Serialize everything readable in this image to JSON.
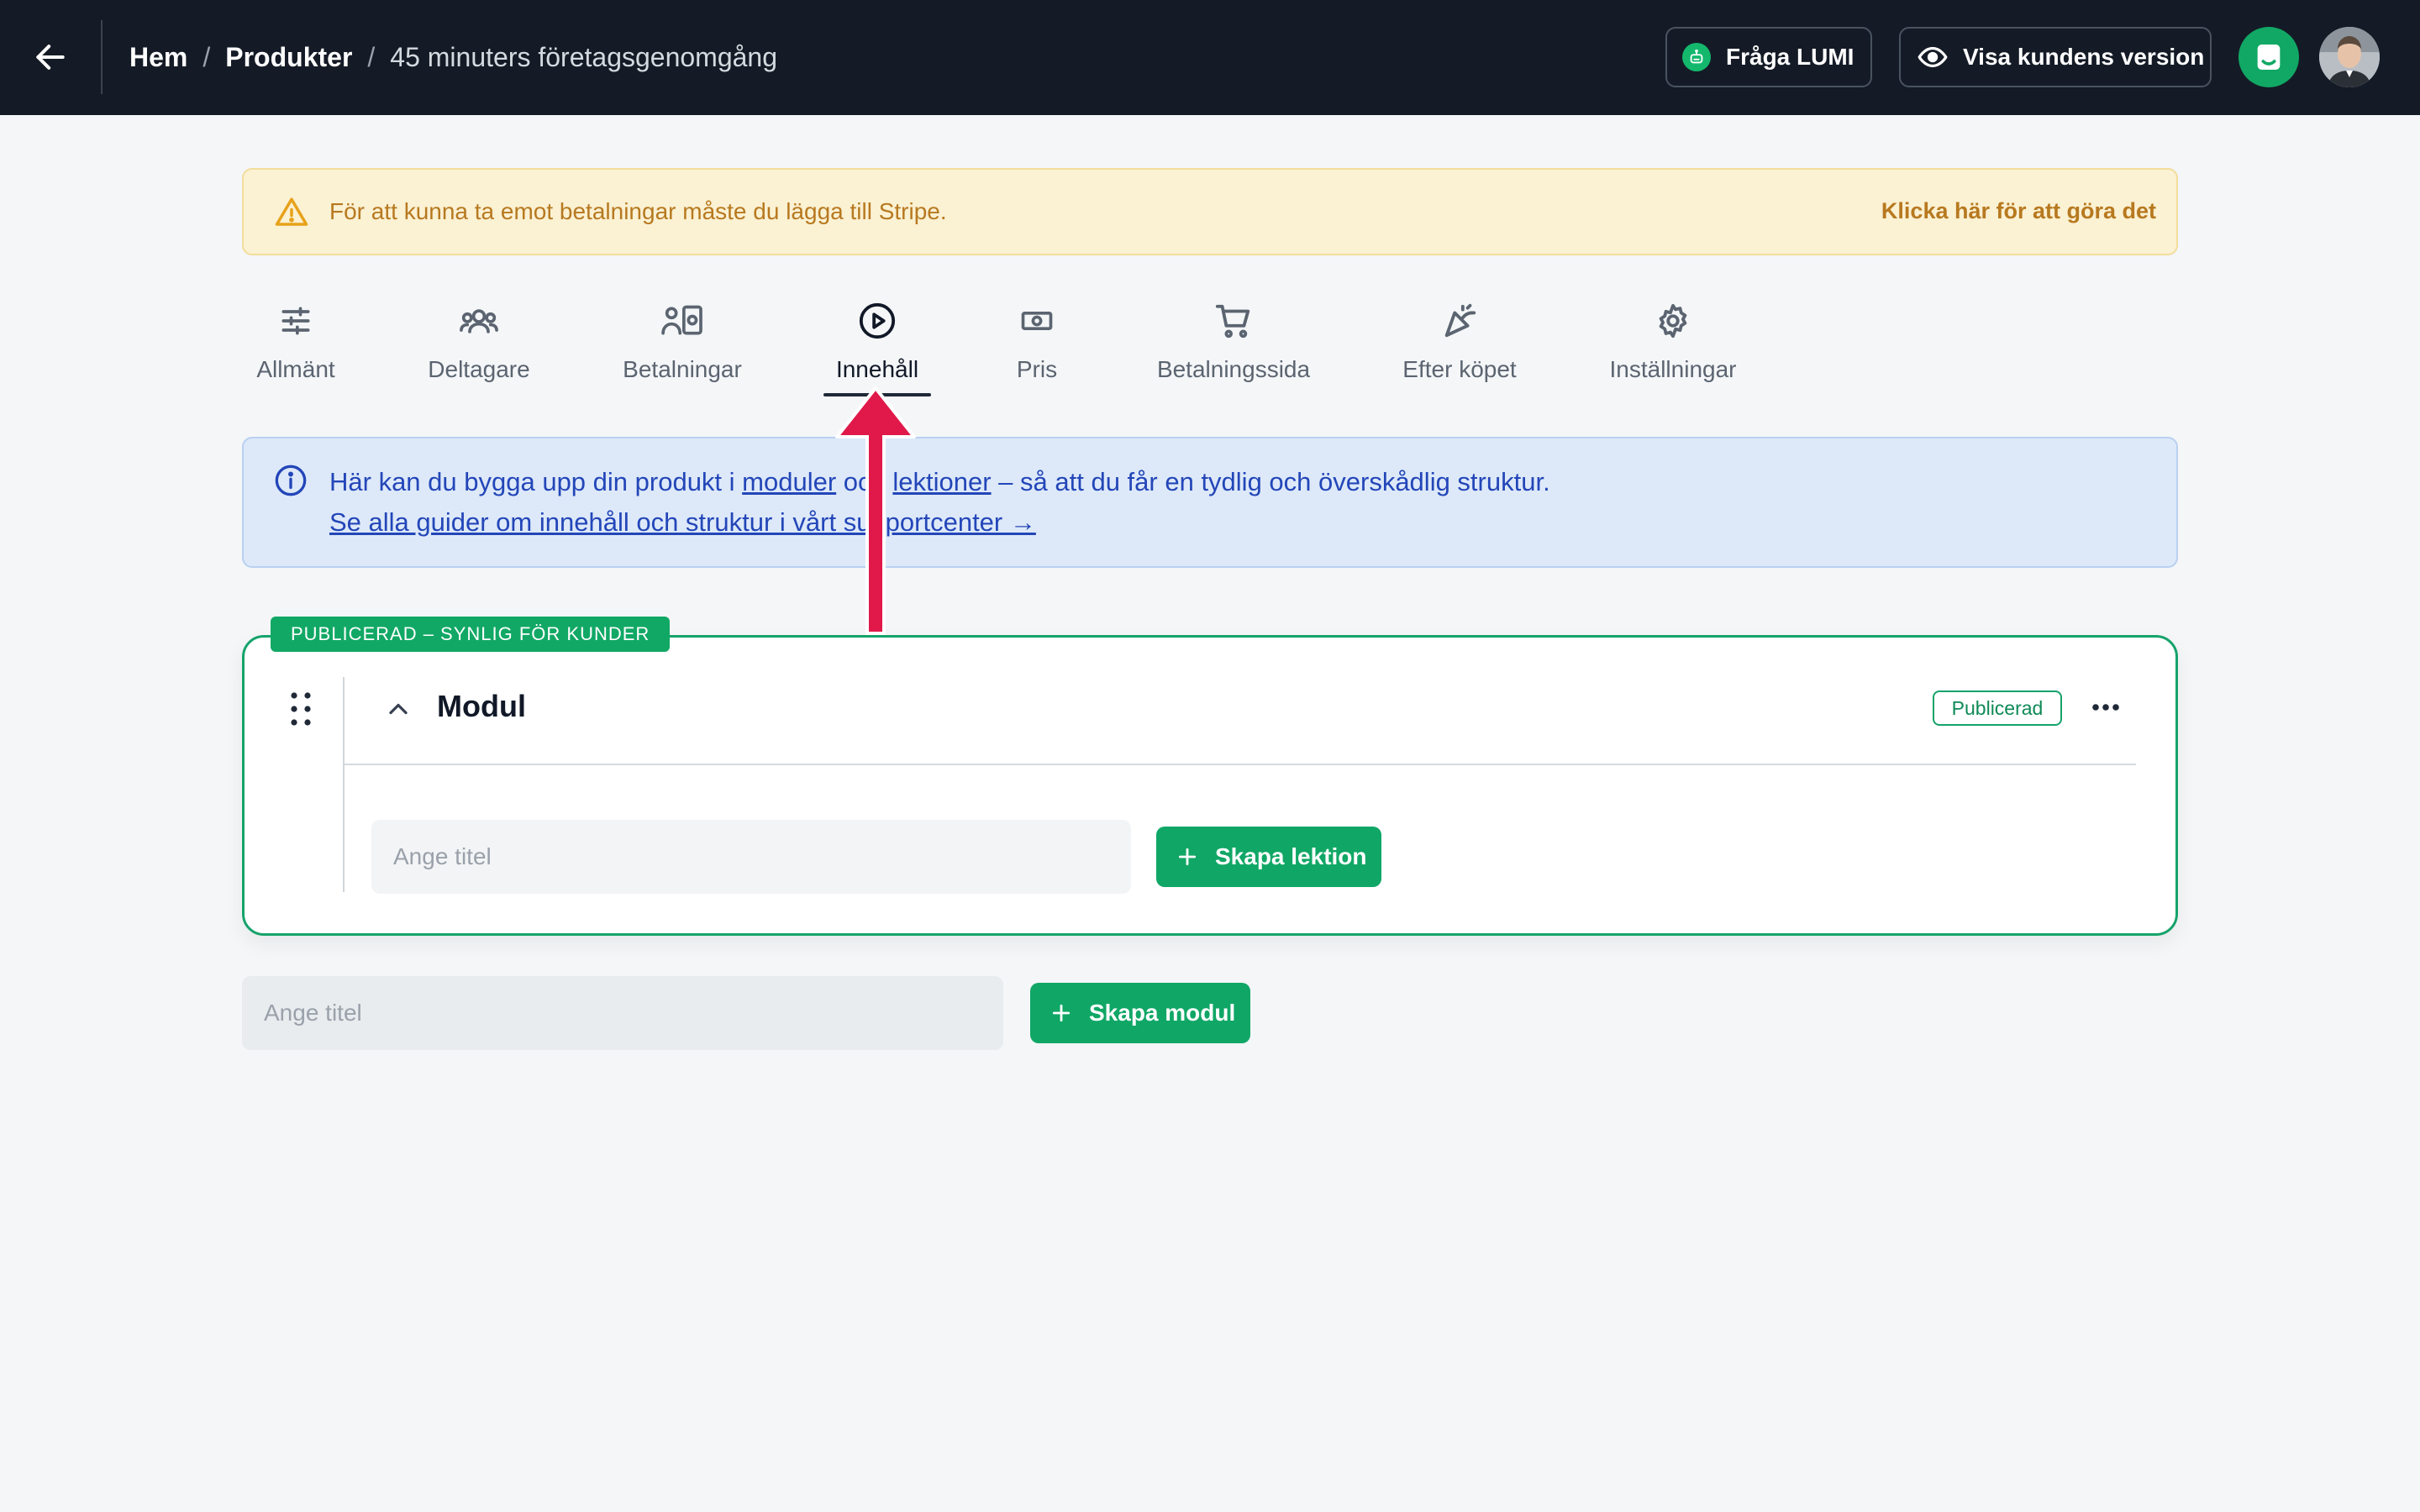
{
  "topbar": {
    "breadcrumb": {
      "home": "Hem",
      "separator1": "/",
      "products": "Produkter",
      "separator2": "/",
      "current": "45 minuters företagsgenomgång"
    },
    "ask_lumi_label": "Fråga LUMI",
    "view_customer_label": "Visa kundens version"
  },
  "warning": {
    "text": "För att kunna ta emot betalningar måste du lägga till Stripe.",
    "link": "Klicka här för att göra det"
  },
  "tabs": [
    {
      "label": "Allmänt",
      "icon": "sliders-icon"
    },
    {
      "label": "Deltagare",
      "icon": "users-icon"
    },
    {
      "label": "Betalningar",
      "icon": "payments-icon"
    },
    {
      "label": "Innehåll",
      "icon": "play-circle-icon",
      "active": true
    },
    {
      "label": "Pris",
      "icon": "money-icon"
    },
    {
      "label": "Betalningssida",
      "icon": "cart-icon"
    },
    {
      "label": "Efter köpet",
      "icon": "party-icon"
    },
    {
      "label": "Inställningar",
      "icon": "gear-icon"
    }
  ],
  "info": {
    "line1_prefix": "Här kan du bygga upp din produkt i ",
    "line1_link1": "moduler",
    "line1_mid": " och ",
    "line1_link2": "lektioner",
    "line1_suffix": " – så att du får en tydlig och överskådlig struktur.",
    "line2_link": "Se alla guider om innehåll och struktur i vårt supportcenter →"
  },
  "module": {
    "tag": "PUBLICERAD – SYNLIG FÖR KUNDER",
    "title": "Modul",
    "status": "Publicerad",
    "lesson_input_placeholder": "Ange titel",
    "create_lesson_label": "Skapa lektion"
  },
  "new_module": {
    "input_placeholder": "Ange titel",
    "create_module_label": "Skapa modul"
  },
  "colors": {
    "topbar_bg": "#141b26",
    "accent_green": "#10a766",
    "warning_bg": "#fbf1d3",
    "warning_text": "#b7791f",
    "info_bg": "#dde9f9",
    "info_text": "#2346b8",
    "arrow_red": "#e0194a"
  }
}
